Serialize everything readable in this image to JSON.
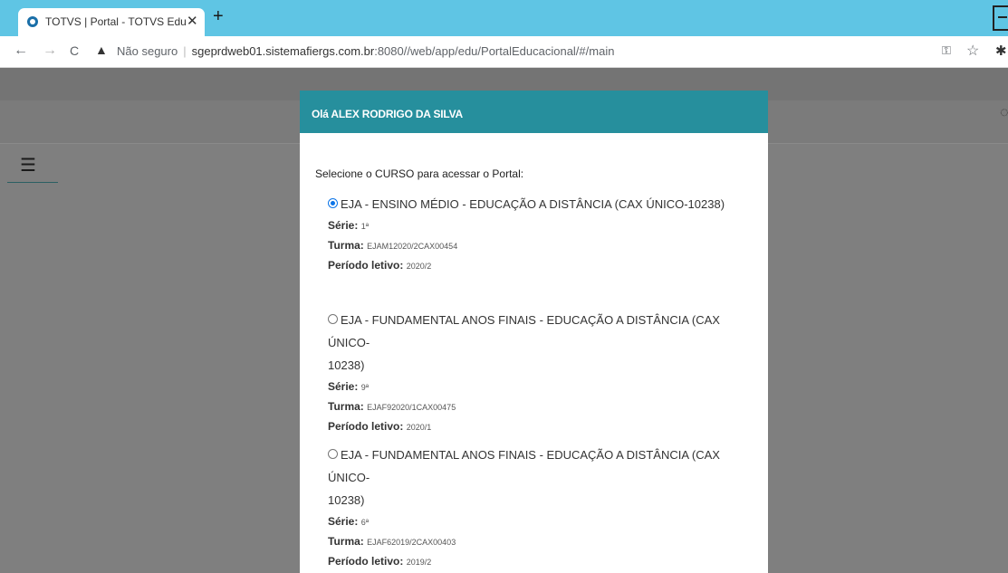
{
  "browser": {
    "tab_title": "TOTVS | Portal - TOTVS Educacional",
    "tab_close": "✕",
    "new_tab": "+",
    "back_icon": "←",
    "forward_icon": "→",
    "reload_icon": "C",
    "security_icon": "▲",
    "security_label": "Não seguro",
    "url_host": "sgeprdweb01.sistemafiergs.com.br",
    "url_rest": ":8080//web/app/edu/PortalEducacional/#/main"
  },
  "modal": {
    "title": "Olá ALEX RODRIGO DA SILVA",
    "prompt": "Selecione o CURSO para acessar o Portal:",
    "labels": {
      "serie": "Série:",
      "turma": "Turma:",
      "periodo": "Período letivo:"
    },
    "courses": [
      {
        "name_line1": "EJA - ENSINO MÉDIO - EDUCAÇÃO A DISTÂNCIA (CAX ÚNICO-10238)",
        "name_line2": "",
        "selected": true,
        "serie": "1ª",
        "turma": "EJAM12020/2CAX00454",
        "periodo": "2020/2"
      },
      {
        "name_line1": "EJA - FUNDAMENTAL ANOS FINAIS - EDUCAÇÃO A DISTÂNCIA (CAX ÚNICO-",
        "name_line2": "10238)",
        "selected": false,
        "serie": "9ª",
        "turma": "EJAF92020/1CAX00475",
        "periodo": "2020/1"
      },
      {
        "name_line1": "EJA - FUNDAMENTAL ANOS FINAIS - EDUCAÇÃO A DISTÂNCIA (CAX ÚNICO-",
        "name_line2": "10238)",
        "selected": false,
        "serie": "6ª",
        "turma": "EJAF62019/2CAX00403",
        "periodo": "2019/2"
      }
    ]
  },
  "colors": {
    "tab_strip": "#5fc5e4",
    "modal_header": "#268f9d",
    "overlay": "#7f7f7f",
    "radio_selected": "#0b74e8"
  },
  "icons": [
    "tab-favicon-icon",
    "close-icon",
    "plus-icon",
    "back-arrow-icon",
    "forward-arrow-icon",
    "reload-icon",
    "warning-icon",
    "key-icon",
    "star-icon",
    "extension-icon",
    "hamburger-menu-icon"
  ]
}
